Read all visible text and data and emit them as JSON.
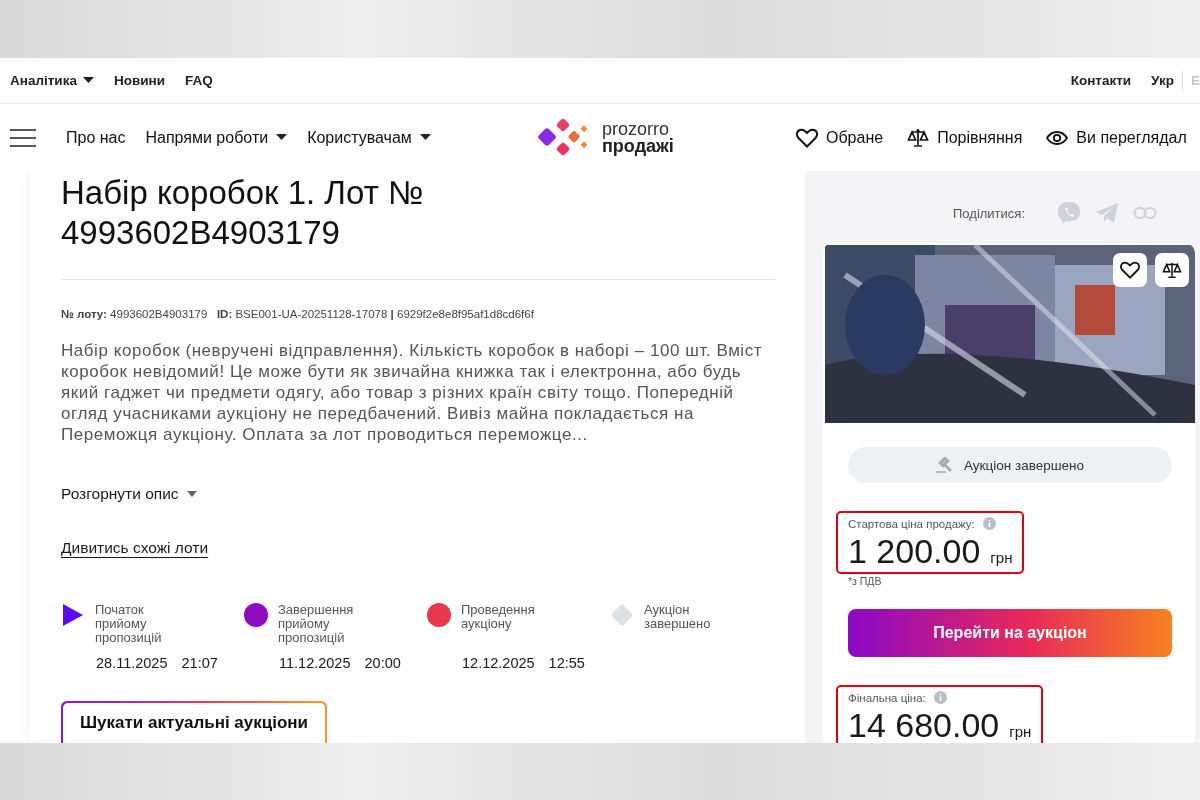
{
  "top_nav": {
    "left": [
      {
        "label": "Аналітика",
        "dropdown": true
      },
      {
        "label": "Новини",
        "dropdown": false
      },
      {
        "label": "FAQ",
        "dropdown": false
      }
    ],
    "right": [
      {
        "label": "Контакти"
      }
    ],
    "languages": [
      {
        "label": "Укр",
        "selected": true
      },
      {
        "label": "E",
        "selected": false
      }
    ]
  },
  "main_nav": {
    "items": [
      {
        "label": "Про нас",
        "dropdown": false
      },
      {
        "label": "Напрями роботи",
        "dropdown": true
      },
      {
        "label": "Користувачам",
        "dropdown": true
      }
    ],
    "logo": {
      "line_1": "prozorro",
      "line_2": "продажі"
    },
    "actions": [
      {
        "kind": "favorite",
        "label": "Обране"
      },
      {
        "kind": "compare",
        "label": "Порівняння"
      },
      {
        "kind": "viewed",
        "label": "Ви переглядал"
      }
    ]
  },
  "lot": {
    "title": "Набір коробок 1. Лот № 4993602B4903179",
    "meta": "**№ лоту:** 4993602B4903179   **ID:** BSE001-UA-20251128-17078 **|** 6929f2e8e8f95af1d8cd6f6f",
    "description": "Набір коробок (невручені відправлення). Кількість коробок в наборі – 100 шт. Вміст коробок невідомий! Це може бути як звичайна книжка так і електронна, або будь який гаджет чи предмети одягу, або товар з різних країн світу тощо. Попередній огляд учасниками аукціону не передбачений. Вивіз майна покладається на Переможця аукціону. Оплата за лот проводиться переможце...",
    "expand_link": "Розгорнути опис",
    "similar_link": "Дивитись схожі лоти",
    "timeline": [
      {
        "kind": "triangle",
        "color": "#5b0cf5",
        "label": "Початок прийому пропозицій",
        "date": "28.11.2025",
        "time": "21:07"
      },
      {
        "kind": "circle",
        "color": "#8e0cc0",
        "label": "Завершення прийому пропозицій",
        "date": "11.12.2025",
        "time": "20:00"
      },
      {
        "kind": "circle",
        "color": "#e8384f",
        "label": "Проведення аукціону",
        "date": "12.12.2025",
        "time": "12:55"
      },
      {
        "kind": "diamond",
        "color": "#dfe1e6",
        "label": "Аукціон завершено"
      }
    ],
    "search_button": "Шукати актуальні аукціони"
  },
  "sidebar": {
    "share_label": "Поділитися:",
    "status": "Аукціон завершено",
    "start_price": {
      "label": "Стартова ціна продажу:",
      "amount": "1 200.00",
      "currency": "грн",
      "note": "*з ПДВ",
      "highlighted": true
    },
    "auction_button": "Перейти на аукціон",
    "final_price": {
      "label": "Фінальна ціна:",
      "amount": "14 680.00",
      "currency": "грн",
      "highlighted": true
    }
  }
}
